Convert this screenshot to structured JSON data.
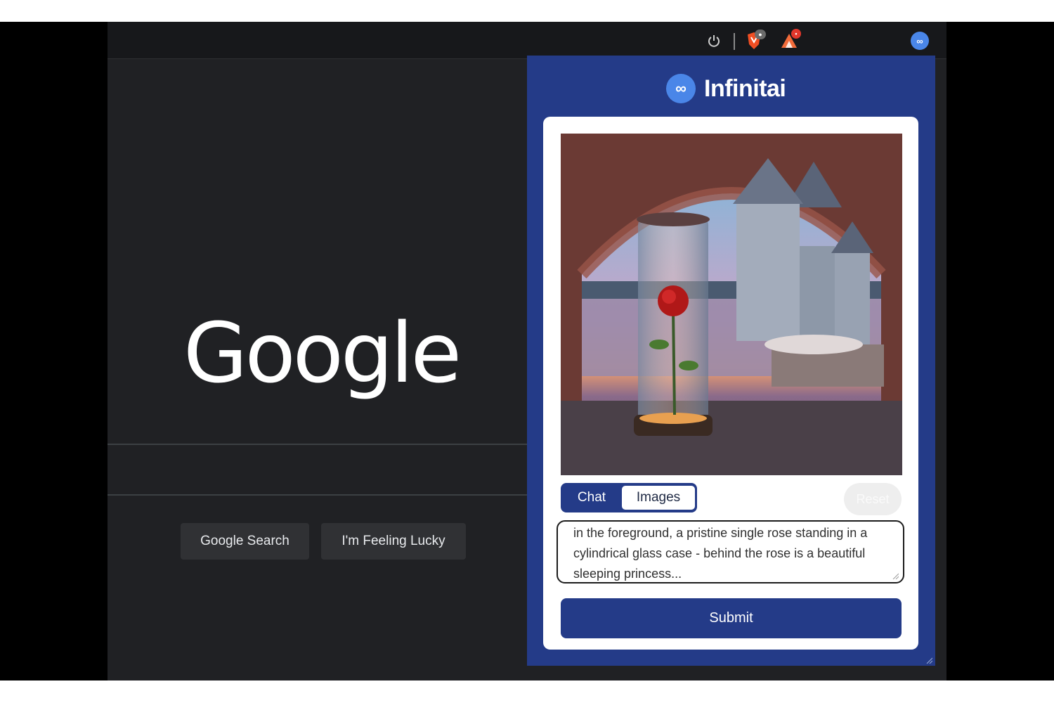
{
  "google": {
    "logo_text": "Google",
    "search_button": "Google Search",
    "lucky_button": "I'm Feeling Lucky"
  },
  "toolbar": {
    "icons": [
      "power-icon",
      "brave-shields-icon",
      "brave-rewards-icon",
      "infinitai-extension-icon"
    ],
    "extension_glyph": "∞"
  },
  "extension": {
    "name": "Infinitai",
    "logo_glyph": "∞",
    "tabs": [
      {
        "label": "Chat",
        "active": false
      },
      {
        "label": "Images",
        "active": true
      }
    ],
    "reset_label": "Reset",
    "prompt_value": "in the foreground, a pristine single rose standing in a cylindrical glass case - behind the rose is a beautiful sleeping princess...",
    "submit_label": "Submit",
    "image_subject": "rose in glass case, castle on lake at sunset, sleeping princess"
  },
  "colors": {
    "popup_bg": "#243b88",
    "brand_blue": "#4a86e8",
    "page_bg": "#202124"
  }
}
